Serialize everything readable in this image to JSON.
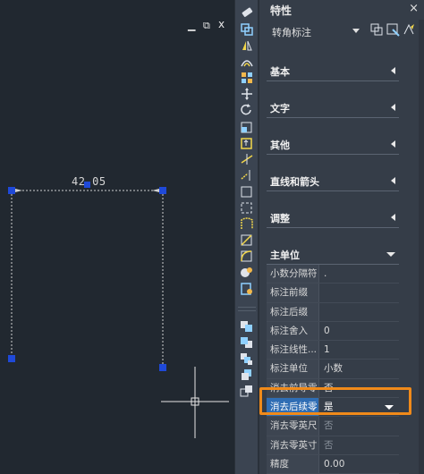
{
  "window": {
    "minimize_label": "▁",
    "restore_label": "⧉",
    "close_label": "x"
  },
  "drawing": {
    "dimension_text": "42.05"
  },
  "props": {
    "title": "特性",
    "close_label": "×",
    "object_type": "转角标注",
    "sections": [
      {
        "label": "基本",
        "state": "collapsed"
      },
      {
        "label": "文字",
        "state": "collapsed"
      },
      {
        "label": "其他",
        "state": "collapsed"
      },
      {
        "label": "直线和箭头",
        "state": "collapsed"
      },
      {
        "label": "调整",
        "state": "collapsed"
      },
      {
        "label": "主单位",
        "state": "expanded"
      }
    ],
    "rows": [
      {
        "label": "小数分隔符",
        "value": "."
      },
      {
        "label": "标注前缀",
        "value": ""
      },
      {
        "label": "标注后缀",
        "value": ""
      },
      {
        "label": "标注舍入",
        "value": "0"
      },
      {
        "label": "标注线性...",
        "value": "1"
      },
      {
        "label": "标注单位",
        "value": "小数"
      },
      {
        "label": "消去前导零",
        "value": "否"
      },
      {
        "label": "消去后续零",
        "value": "是"
      },
      {
        "label": "消去零英尺",
        "value": "否"
      },
      {
        "label": "消去零英寸",
        "value": "否"
      },
      {
        "label": "精度",
        "value": "0.00"
      }
    ]
  },
  "colors": {
    "grip": "#1f49d8",
    "highlight": "#f08a1a",
    "selected_row": "#2f6db4"
  }
}
